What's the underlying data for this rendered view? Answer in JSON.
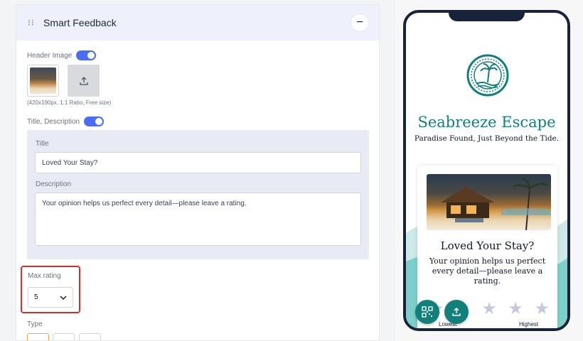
{
  "editor": {
    "section_title": "Smart Feedback",
    "header_image_label": "Header Image",
    "image_hint": "(420x190px, 1:1 Ratio, Free size)",
    "title_desc_label": "Title, Description",
    "title_label": "Title",
    "title_value": "Loved Your Stay?",
    "description_label": "Description",
    "description_value": "Your opinion helps us perfect every detail—please leave a rating.",
    "max_rating_label": "Max rating",
    "max_rating_value": "5",
    "type_label": "Type"
  },
  "preview": {
    "brand_name": "Seabreeze Escape",
    "tagline": "Paradise Found, Just Beyond the Tide.",
    "card_title": "Loved Your Stay?",
    "card_description": "Your opinion helps us perfect every detail—please leave a rating.",
    "lowest_label": "Lowest",
    "highest_label": "Highest",
    "star_count": 5,
    "star_glyph": "★"
  },
  "colors": {
    "accent": "#4a6cf7",
    "brand": "#127f7a",
    "highlight": "#d32f2f"
  }
}
